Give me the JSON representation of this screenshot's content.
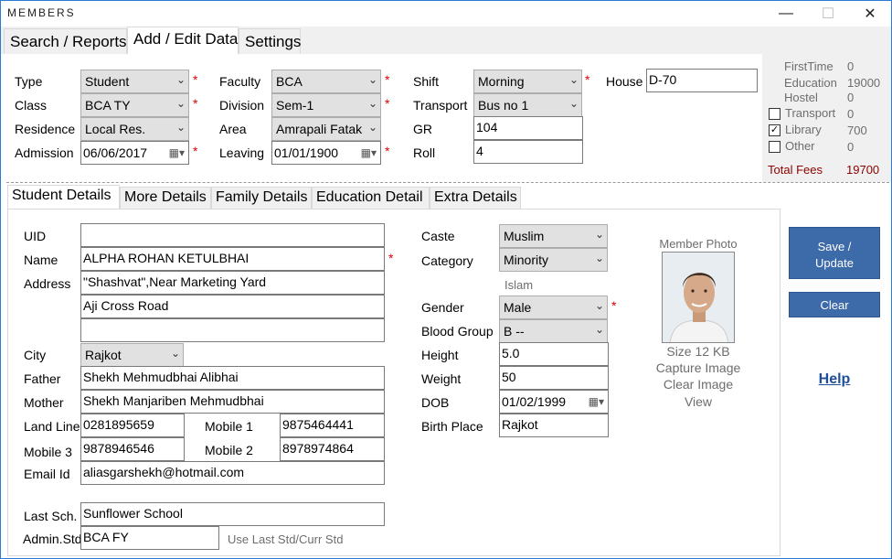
{
  "window": {
    "title": "MEMBERS",
    "minimize": "—",
    "maximize": "☐",
    "close": "✕"
  },
  "main_tabs": [
    "Search  / Reports",
    "Add / Edit Data",
    "Settings"
  ],
  "form": {
    "type_label": "Type",
    "type_value": "Student",
    "class_label": "Class",
    "class_value": "BCA TY",
    "residence_label": "Residence",
    "residence_value": "Local Res.",
    "admission_label": "Admission",
    "admission_value": "06/06/2017",
    "faculty_label": "Faculty",
    "faculty_value": "BCA",
    "division_label": "Division",
    "division_value": "Sem-1",
    "area_label": "Area",
    "area_value": "Amrapali Fatak",
    "leaving_label": "Leaving",
    "leaving_value": "01/01/1900",
    "shift_label": "Shift",
    "shift_value": "Morning",
    "transport_label": "Transport",
    "transport_value": "Bus no 1",
    "gr_label": "GR",
    "gr_value": "104",
    "roll_label": "Roll",
    "roll_value": "4",
    "house_label": "House",
    "house_value": "D-70"
  },
  "fees": {
    "firsttime_label": "FirstTime",
    "firsttime_value": "0",
    "education_label": "Education",
    "education_value": "19000",
    "hostel_label": "Hostel",
    "hostel_value": "0",
    "transport_label": "Transport",
    "transport_value": "0",
    "transport_checked": false,
    "library_label": "Library",
    "library_value": "700",
    "library_checked": true,
    "other_label": "Other",
    "other_value": "0",
    "other_checked": false,
    "total_label": "Total Fees",
    "total_value": "19700",
    "total_color": "#8b0000"
  },
  "sub_tabs": [
    "Student Details",
    "More Details",
    "Family Details",
    "Education Detail",
    "Extra Details"
  ],
  "student": {
    "uid_label": "UID",
    "uid_value": "",
    "name_label": "Name",
    "name_value": "ALPHA ROHAN KETULBHAI",
    "address_label": "Address",
    "address_line1": "\"Shashvat\",Near Marketing Yard",
    "address_line2": "Aji Cross Road",
    "address_line3": "",
    "city_label": "City",
    "city_value": "Rajkot",
    "father_label": "Father",
    "father_value": "Shekh Mehmudbhai Alibhai",
    "mother_label": "Mother",
    "mother_value": "Shekh Manjariben Mehmudbhai",
    "landline_label": "Land Line",
    "landline_value": "0281895659",
    "mobile1_label": "Mobile 1",
    "mobile1_value": "9875464441",
    "mobile3_label": "Mobile 3",
    "mobile3_value": "9878946546",
    "mobile2_label": "Mobile 2",
    "mobile2_value": "8978974864",
    "email_label": "Email Id",
    "email_value": "aliasgarshekh@hotmail.com",
    "lastsch_label": "Last Sch.",
    "lastsch_value": "Sunflower School",
    "adminstd_label": "Admin.Std",
    "adminstd_value": "BCA FY",
    "use_last_std": "Use Last Std/Curr Std",
    "caste_label": "Caste",
    "caste_value": "Muslim",
    "category_label": "Category",
    "category_value": "Minority",
    "religion": "Islam",
    "gender_label": "Gender",
    "gender_value": "Male",
    "bloodgroup_label": "Blood Group",
    "bloodgroup_value": "B --",
    "height_label": "Height",
    "height_value": "5.0",
    "weight_label": "Weight",
    "weight_value": "50",
    "dob_label": "DOB",
    "dob_value": "01/02/1999",
    "birthplace_label": "Birth Place",
    "birthplace_value": "Rajkot"
  },
  "photo": {
    "title": "Member Photo",
    "size": "Size 12 KB",
    "capture": "Capture Image",
    "clear": "Clear Image",
    "view": "View"
  },
  "actions": {
    "save": "Save /\nUpdate",
    "clear": "Clear",
    "help": "Help"
  },
  "required_mark": "*",
  "colors": {
    "accent": "#3d6aa8",
    "required": "#e00000",
    "help_link": "#1f4e9c"
  }
}
